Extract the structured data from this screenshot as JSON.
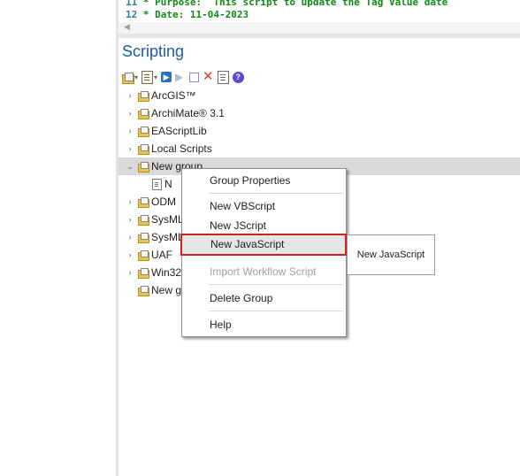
{
  "code": {
    "lines": [
      {
        "num": "11",
        "text": " * Purpose:  This script to update the Tag Value date"
      },
      {
        "num": "12",
        "text": " * Date: 11-04-2023"
      }
    ],
    "scroll_left_glyph": "◀"
  },
  "panel": {
    "title": "Scripting"
  },
  "toolbar": {
    "items": [
      {
        "icon": "new-script-group-icon",
        "dropdown": true
      },
      {
        "icon": "new-script-icon",
        "dropdown": true
      },
      {
        "icon": "run-script-icon"
      },
      {
        "icon": "debug-script-icon"
      },
      {
        "icon": "stop-script-icon"
      },
      {
        "icon": "delete-icon"
      },
      {
        "icon": "properties-icon"
      },
      {
        "icon": "help-icon"
      }
    ]
  },
  "tree": {
    "items": [
      {
        "label": "ArcGIS™",
        "expandable": true
      },
      {
        "label": "ArchiMate® 3.1",
        "expandable": true
      },
      {
        "label": "EAScriptLib",
        "expandable": true
      },
      {
        "label": "Local Scripts",
        "expandable": true
      },
      {
        "label": "New group",
        "expanded": true,
        "selected": true
      },
      {
        "label": "N",
        "child": true
      },
      {
        "label": "ODM",
        "expandable": true
      },
      {
        "label": "SysML",
        "expandable": true
      },
      {
        "label": "SysML",
        "expandable": true
      },
      {
        "label": "UAF",
        "expandable": true
      },
      {
        "label": "Win32",
        "expandable": true
      },
      {
        "label": "New g",
        "expandable": false
      }
    ]
  },
  "context_menu": {
    "items": [
      {
        "label": "Group Properties"
      },
      {
        "label": "New VBScript"
      },
      {
        "label": "New JScript"
      },
      {
        "label": "New JavaScript",
        "highlighted": true
      },
      {
        "label": "Import Workflow Script",
        "disabled": true
      },
      {
        "label": "Delete Group"
      },
      {
        "label": "Help"
      }
    ]
  },
  "tooltip": {
    "text": "New JavaScript"
  },
  "colors": {
    "title": "#1e5aa8",
    "code_comment": "#0e8a16",
    "highlight_border": "#d11f1f"
  }
}
